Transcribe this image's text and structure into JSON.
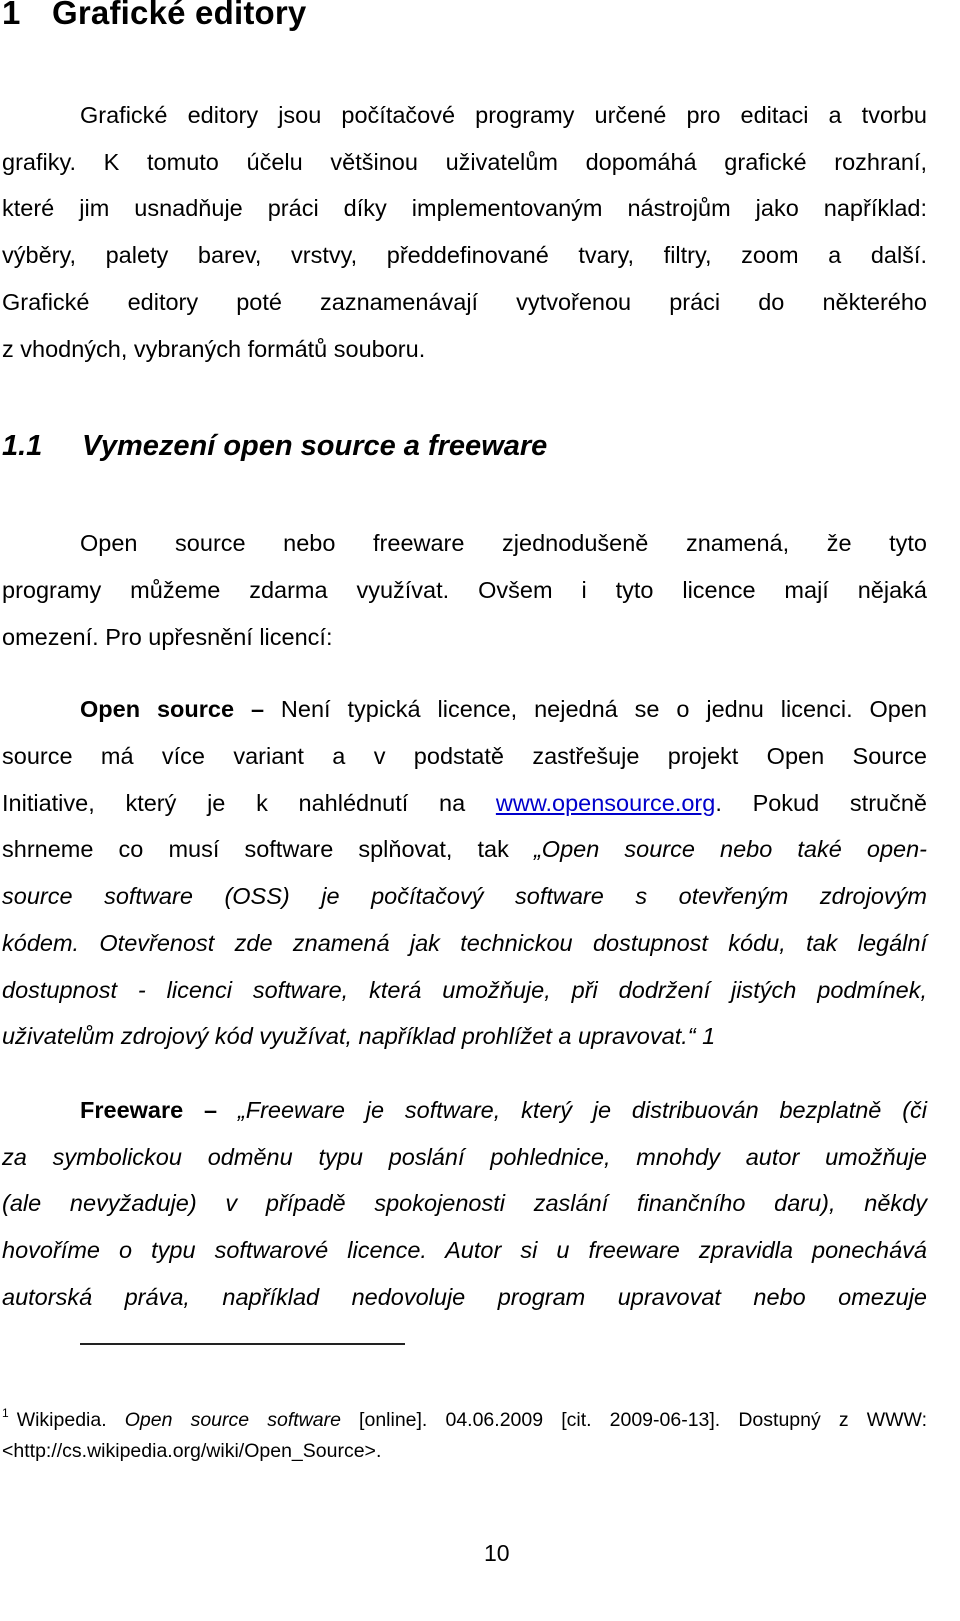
{
  "chapter": {
    "number": "1",
    "title": "Grafické editory"
  },
  "intro_lines": [
    "Grafické editory jsou počítačové programy určené pro editaci a tvorbu",
    "grafiky. K tomuto účelu většinou uživatelům dopomáhá grafické rozhraní,",
    "které jim usnadňuje práci díky implementovaným nástrojům jako například:",
    "výběry, palety barev, vrstvy, předdefinované tvary, filtry, zoom a další.",
    "Grafické editory poté zaznamenávají vytvořenou práci do některého",
    "z vhodných, vybraných formátů souboru."
  ],
  "section": {
    "number": "1.1",
    "title": "Vymezení open source a freeware"
  },
  "section_intro_lines": [
    "Open source nebo freeware zjednodušeně znamená, že tyto",
    "programy můžeme zdarma využívat. Ovšem i tyto licence mají nějaká",
    "omezení. Pro upřesnění licencí:"
  ],
  "open_source": {
    "term": "Open source –",
    "line1_rest": " Není typická licence, nejedná se o jednu licenci. Open",
    "line2": "source má více variant a v podstatě zastřešuje projekt Open Source",
    "line3_pre": "Initiative, který je k nahlédnutí na ",
    "link": "www.opensource.org",
    "line3_post": ". Pokud stručně",
    "line4_plain": "shrneme co musí software splňovat, tak ",
    "line4_italic": "„Open source nebo také open-",
    "line5": "source software (OSS) je počítačový software s otevřeným zdrojovým",
    "line6": "kódem. Otevřenost zde znamená jak technickou dostupnost kódu, tak legální",
    "line7": "dostupnost - licenci software, která umožňuje, při dodržení jistých podmínek,",
    "line8": "uživatelům zdrojový kód využívat, například prohlížet a upravovat.“ 1"
  },
  "freeware": {
    "term": "Freeware –",
    "line1_rest": " „Freeware je software, který je distribuován bezplatně (či",
    "line2": "za symbolickou odměnu typu poslání pohlednice, mnohdy autor umožňuje",
    "line3": "(ale nevyžaduje) v případě spokojenosti zaslání finančního daru), někdy",
    "line4": "hovoříme o typu softwarové licence. Autor si u freeware zpravidla ponechává",
    "line5": "autorská práva, například nedovoluje program upravovat nebo omezuje"
  },
  "footnote": {
    "marker": "1",
    "pre": "Wikipedia. ",
    "title": "Open source software",
    "post": " [online]. 04.06.2009 [cit. 2009-06-13]. Dostupný z WWW:",
    "url_line": "<http://cs.wikipedia.org/wiki/Open_Source>."
  },
  "page_number": "10",
  "colors": {
    "link": "#0000cc",
    "text": "#000000"
  }
}
